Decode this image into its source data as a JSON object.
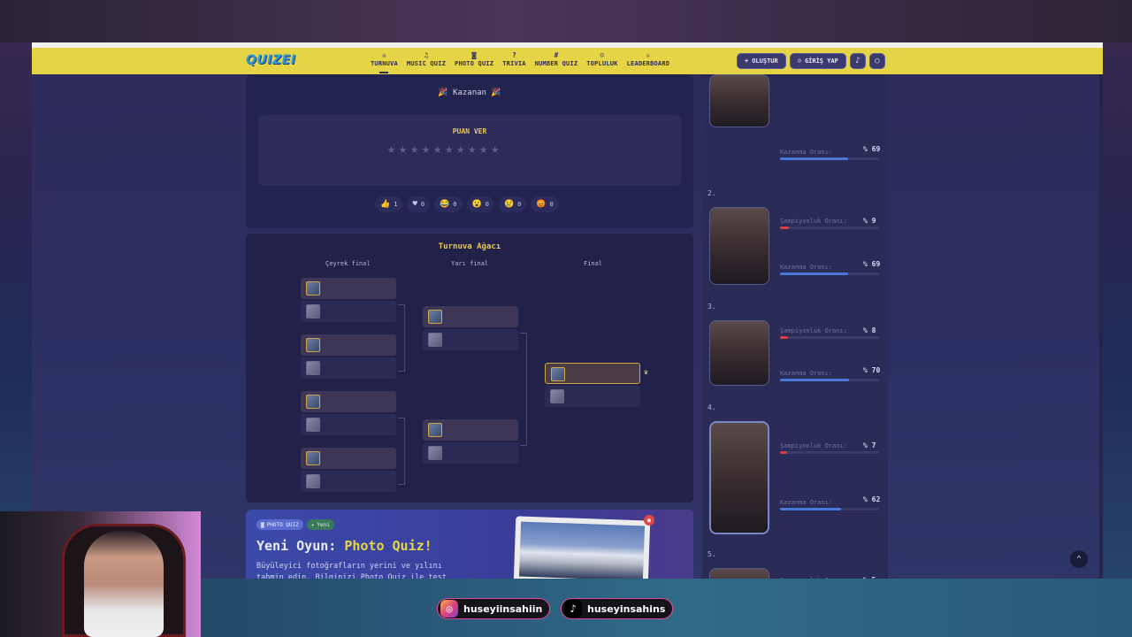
{
  "site": {
    "logo": "QUIZEI",
    "nav": [
      {
        "label": "TURNUVA",
        "icon": "trophy-icon",
        "glyph": "♔",
        "active": true
      },
      {
        "label": "MUSIC QUIZ",
        "icon": "music-icon",
        "glyph": "♫"
      },
      {
        "label": "PHOTO QUIZ",
        "icon": "camera-icon",
        "glyph": "◙"
      },
      {
        "label": "TRIVIA",
        "icon": "question-icon",
        "glyph": "?"
      },
      {
        "label": "NUMBER QUIZ",
        "icon": "hash-icon",
        "glyph": "#"
      },
      {
        "label": "TOPLULUK",
        "icon": "users-icon",
        "glyph": "☺"
      },
      {
        "label": "LEADERBOARD",
        "icon": "medal-icon",
        "glyph": "♕"
      }
    ],
    "create_label": "OLUŞTUR",
    "login_label": "GİRİŞ YAP"
  },
  "winner": {
    "label": "Kazanan",
    "rate_title": "PUAN VER",
    "star_count": 10,
    "reactions": [
      {
        "emoji": "👍",
        "count": "1"
      },
      {
        "emoji": "♥",
        "count": "0"
      },
      {
        "emoji": "😂",
        "count": "0"
      },
      {
        "emoji": "😮",
        "count": "0"
      },
      {
        "emoji": "😢",
        "count": "0"
      },
      {
        "emoji": "😡",
        "count": "0"
      }
    ]
  },
  "bracket": {
    "title": "Turnuva Ağacı",
    "rounds": [
      "Çeyrek final",
      "Yarı final",
      "Final"
    ]
  },
  "promo": {
    "tag_photo": "PHOTO QUIZ",
    "tag_new": "Yeni",
    "title_prefix": "Yeni Oyun: ",
    "title_highlight": "Photo Quiz!",
    "desc": "Büyüleyici fotoğrafların yerini ve yılını tahmin edin. Bilginizi Photo Quiz ile test"
  },
  "ranking": {
    "champ_label": "Şampiyonluk Oranı:",
    "win_label": "Kazanma Oranı:",
    "items": [
      {
        "rank": "",
        "win": "% 69",
        "win_pct": 69
      },
      {
        "rank": "2.",
        "champ": "% 9",
        "champ_pct": 9,
        "win": "% 69",
        "win_pct": 69
      },
      {
        "rank": "3.",
        "champ": "% 8",
        "champ_pct": 8,
        "win": "% 70",
        "win_pct": 70
      },
      {
        "rank": "4.",
        "champ": "% 7",
        "champ_pct": 7,
        "win": "% 62",
        "win_pct": 62
      },
      {
        "rank": "5.",
        "champ": "% 5",
        "champ_pct": 5
      }
    ]
  },
  "social": {
    "instagram": "huseyiinsahiin",
    "tiktok": "huseyinsahins"
  }
}
